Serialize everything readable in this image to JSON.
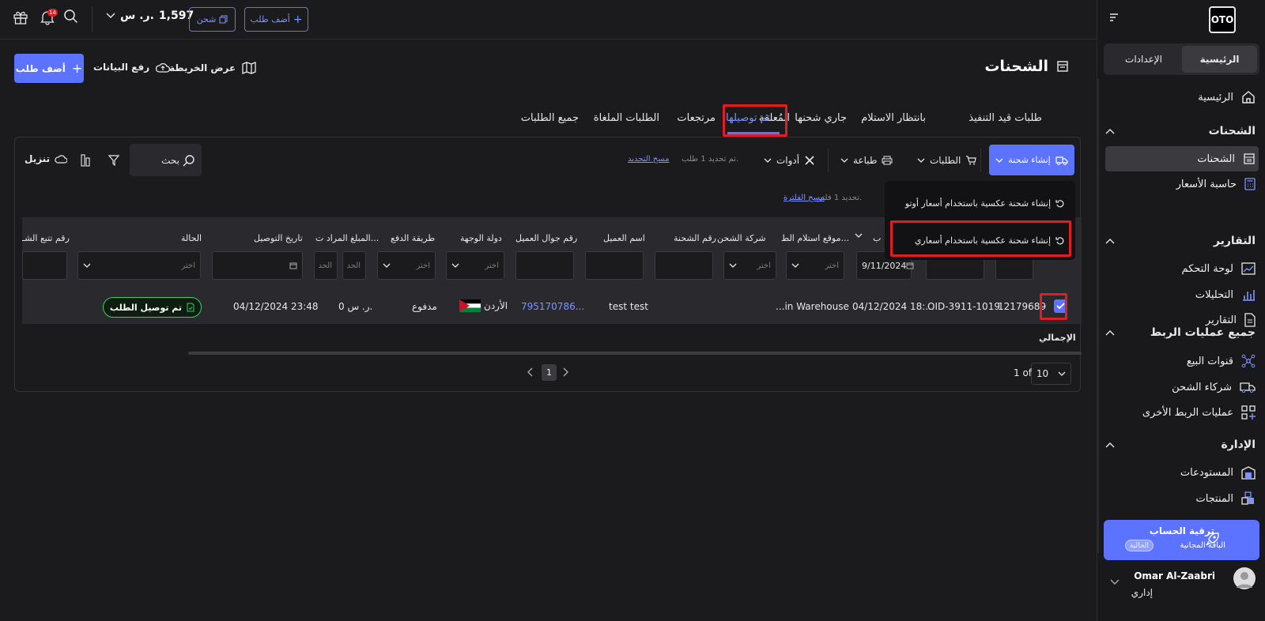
{
  "sidebar": {
    "logo": "OTO",
    "seg": {
      "home": "الرئيسية",
      "settings": "الإعدادات"
    },
    "home_link": "الرئيسية",
    "sections": [
      {
        "title": "الشحنات",
        "items": [
          "الشحنات",
          "حاسبة الأسعار"
        ]
      },
      {
        "title": "التقارير",
        "items": [
          "لوحة التحكم",
          "التحليلات",
          "التقارير"
        ]
      },
      {
        "title": "جميع عمليات الربط",
        "items": [
          "قنوات البيع",
          "شركاء الشحن",
          "عمليات الربط الأخرى"
        ]
      },
      {
        "title": "الإدارة",
        "items": [
          "المستودعات",
          "المنتجات"
        ]
      }
    ],
    "upgrade": {
      "title": "ترقية الحساب",
      "plan": "الباقة المجانية",
      "badge": "الحالية"
    },
    "user": {
      "name": "Omar Al-Zaabri",
      "role": "إداري"
    }
  },
  "topbar": {
    "add_order": "أضف طلب",
    "ship": "شحن",
    "balance": "1,597",
    "currency": "ر. س.",
    "notif_count": "14"
  },
  "page": {
    "title": "الشحنات",
    "map": "عرض الخريطة",
    "upload": "رفع البيانات",
    "add_order": "أضف طلب"
  },
  "tabs": [
    "طلبات قيد التنفيذ",
    "بانتظار الاستلام",
    "جاري شحنها",
    "المُعلقة",
    "تم توصيلها",
    "مرتجعات",
    "الطلبات الملغاة",
    "جميع الطلبات"
  ],
  "toolbar": {
    "create_shipment": "إنشاء شحنة",
    "orders": "الطلبات",
    "print": "طباعة",
    "tools": "أدوات",
    "selected_note": "تم تحديد 1 طلب.",
    "clear_selection": "مسح التحديد",
    "search_placeholder": "بحث",
    "download": "تنزيل",
    "filter_note": "تحديد 1 فلتر.",
    "clear_filter": "مسح الفلترة"
  },
  "dropdown": {
    "item1": "إنشاء شحنة عكسية باستخدام أسعار أوتو",
    "item2": "إنشاء شحنة عكسية باستخدام أسعاري"
  },
  "table": {
    "headers": {
      "c_partial": "ب",
      "pickup": "موقع استلام الط...",
      "carrier": "شركة الشحن",
      "shipment_no": "رقم الشحنة",
      "customer": "اسم العميل",
      "phone": "رقم جوال العميل",
      "country": "دولة الوجهة",
      "payment": "طريقة الدفع",
      "amount": "المبلغ المراد ت...",
      "delivery_date": "تاريخ التوصيل",
      "status": "الحالة",
      "tracking": "رقم تتبع الشـ"
    },
    "filters": {
      "choose": "اختر",
      "limit": "الحد",
      "date_value": "9/11/2024"
    },
    "row": {
      "order_id": "12179689",
      "oid": "OID-3911-1019",
      "created": "04/12/2024 18:...",
      "pickup": "...in Warehouse",
      "customer": "test test",
      "phone": "795170786...",
      "country": "الأردن",
      "payment": "مدفوع",
      "amount": "0 ر. س.",
      "delivery_date": "04/12/2024 23:48",
      "status": "تم توصيل الطلب"
    },
    "total_label": "الإجمالي"
  },
  "pagination": {
    "page_size": "10",
    "of": "1 of",
    "page": "1"
  },
  "colors": {
    "accent": "#5b73ff",
    "highlight": "#e31b23",
    "status_green": "#37d067"
  }
}
